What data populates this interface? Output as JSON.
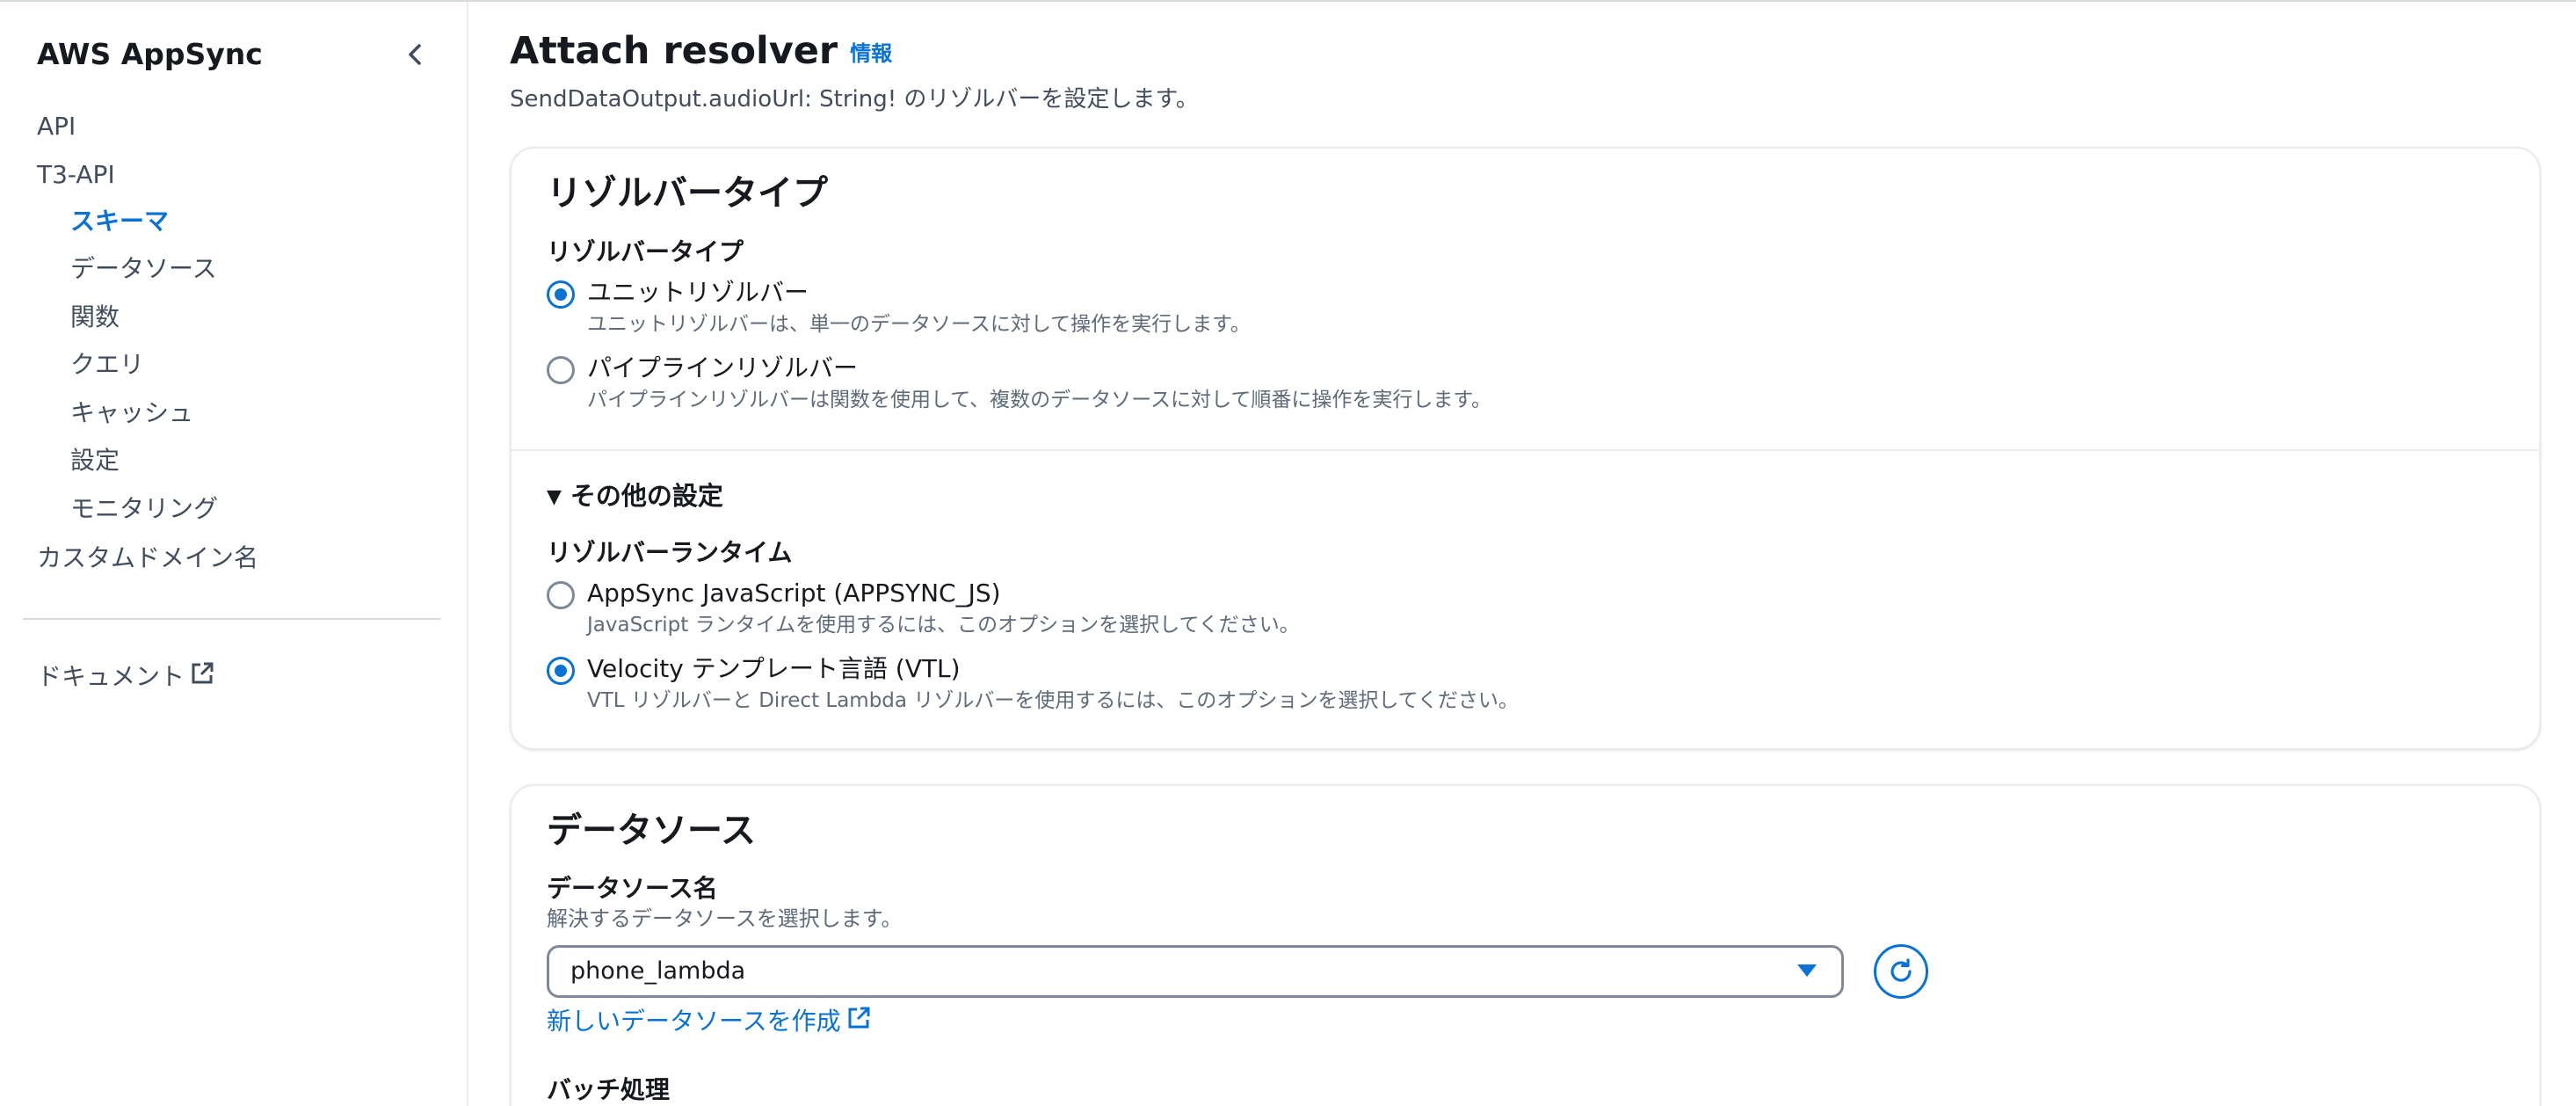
{
  "sidebar": {
    "title": "AWS AppSync",
    "items": [
      {
        "label": "API"
      },
      {
        "label": "T3-API"
      },
      {
        "label": "スキーマ"
      },
      {
        "label": "データソース"
      },
      {
        "label": "関数"
      },
      {
        "label": "クエリ"
      },
      {
        "label": "キャッシュ"
      },
      {
        "label": "設定"
      },
      {
        "label": "モニタリング"
      },
      {
        "label": "カスタムドメイン名"
      }
    ],
    "docs_label": "ドキュメント"
  },
  "header": {
    "title": "Attach resolver",
    "info_label": "情報",
    "description": "SendDataOutput.audioUrl: String! のリゾルバーを設定します。"
  },
  "resolver_panel": {
    "heading": "リゾルバータイプ",
    "type_label": "リゾルバータイプ",
    "options": [
      {
        "label": "ユニットリゾルバー",
        "description": "ユニットリゾルバーは、単一のデータソースに対して操作を実行します。",
        "selected": true
      },
      {
        "label": "パイプラインリゾルバー",
        "description": "パイプラインリゾルバーは関数を使用して、複数のデータソースに対して順番に操作を実行します。",
        "selected": false
      }
    ],
    "other_settings_label": "その他の設定",
    "runtime_label": "リゾルバーランタイム",
    "runtime_options": [
      {
        "label": "AppSync JavaScript (APPSYNC_JS)",
        "description": "JavaScript ランタイムを使用するには、このオプションを選択してください。",
        "selected": false
      },
      {
        "label": "Velocity テンプレート言語 (VTL)",
        "description": "VTL リゾルバーと Direct Lambda リゾルバーを使用するには、このオプションを選択してください。",
        "selected": true
      }
    ]
  },
  "datasource_panel": {
    "heading": "データソース",
    "name_label": "データソース名",
    "hint": "解決するデータソースを選択します。",
    "selected_value": "phone_lambda",
    "create_link": "新しいデータソースを作成",
    "batch_label": "バッチ処理"
  },
  "colors": {
    "accent": "#0972d3",
    "text": "#16191f",
    "secondary_text": "#5f6b7a",
    "border": "#e9ebed"
  }
}
